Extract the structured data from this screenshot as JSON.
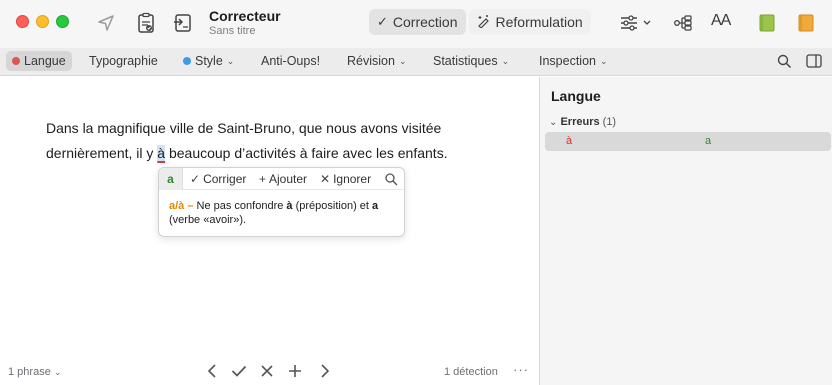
{
  "window": {
    "app_title": "Correcteur",
    "subtitle": "Sans titre"
  },
  "modes": {
    "correction_label": "Correction",
    "reformulation_label": "Reformulation"
  },
  "font_size_label": "AA",
  "tabs": {
    "langue": "Langue",
    "typographie": "Typographie",
    "style": "Style",
    "antioups": "Anti-Oups!",
    "revision": "Révision",
    "statistiques": "Statistiques",
    "inspection": "Inspection"
  },
  "colors": {
    "langue_dot": "#e0554f",
    "style_dot": "#3d9be9",
    "error_red": "#d8322a",
    "fix_green": "#2e8b2e",
    "accent_orange": "#e08a00"
  },
  "document": {
    "text_before": "Dans la magnifique ville de Saint-Bruno, que nous avons visitée dernièrement, il y ",
    "error_word": "à",
    "text_after": " beaucoup d’activités à faire avec les enfants."
  },
  "popover": {
    "suggestion": "a",
    "corriger": "Corriger",
    "ajouter": "Ajouter",
    "ignorer": "Ignorer",
    "rule_title": "a/à –",
    "explain_1": " Ne pas confondre ",
    "word_a_grave": "à",
    "explain_2": " (préposition) et ",
    "word_a": "a",
    "explain_3": " (verbe «avoir»)."
  },
  "footer": {
    "phrase_count": "1 phrase",
    "detections": "1 détection",
    "more": "···"
  },
  "panel": {
    "title": "Langue",
    "errors_label": "Erreurs",
    "errors_count": "(1)",
    "error_original": "à",
    "error_fix": "a"
  }
}
